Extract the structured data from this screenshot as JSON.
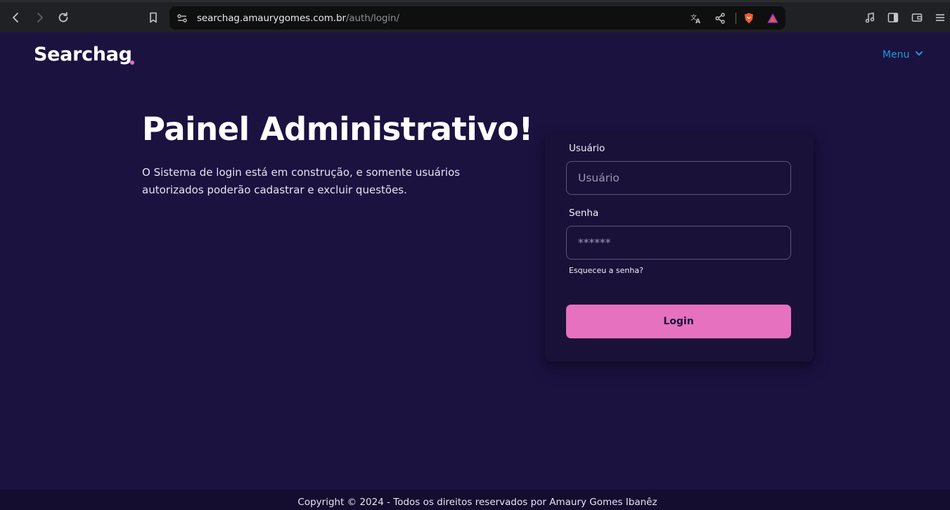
{
  "browser": {
    "url_domain": "searchag.amaurygomes.com.br",
    "url_path": "/auth/login/",
    "icons": [
      "back-icon",
      "forward-icon",
      "reload-icon",
      "bookmark-icon",
      "site-settings-icon",
      "translate-icon",
      "share-icon",
      "brave-shields-icon",
      "brave-rewards-icon",
      "media-icon",
      "sidebar-icon",
      "wallet-icon",
      "menu-icon"
    ]
  },
  "header": {
    "logo": "Searchag",
    "menu_label": "Menu"
  },
  "hero": {
    "title": "Painel Administrativo!",
    "description": "O Sistema de login está em construção, e somente usuários autorizados poderão cadastrar e excluir questões."
  },
  "login": {
    "username_label": "Usuário",
    "username_placeholder": "Usuário",
    "password_label": "Senha",
    "password_placeholder": "******",
    "forgot_label": "Esqueceu a senha?",
    "submit_label": "Login"
  },
  "footer": {
    "copyright": "Copyright © 2024 - Todos os direitos reservados por Amaury Gomes Ibanêz"
  },
  "colors": {
    "background": "#1b1240",
    "accent_pink": "#e671bf",
    "menu_blue": "#1f9bd6",
    "footer_bg": "#140d30"
  }
}
